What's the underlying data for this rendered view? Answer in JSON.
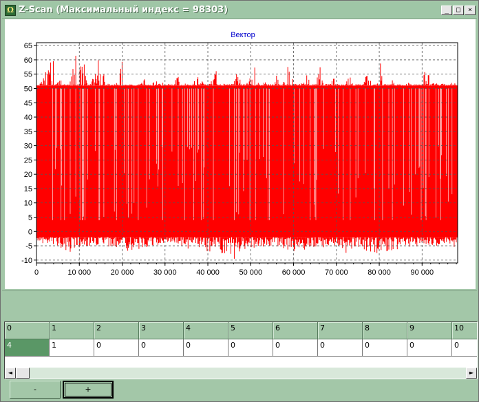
{
  "window": {
    "title": "Z-Scan (Максимальный индекс = 98303)",
    "app_icon": "app-icon",
    "controls": {
      "minimize": "_",
      "maximize": "□",
      "close": "×"
    }
  },
  "chart_data": {
    "type": "bar",
    "title": "Вектор",
    "xlabel": "",
    "ylabel": "",
    "xlim": [
      0,
      98303
    ],
    "ylim": [
      -11,
      66
    ],
    "yticks": [
      -10,
      -5,
      0,
      5,
      10,
      15,
      20,
      25,
      30,
      35,
      40,
      45,
      50,
      55,
      60,
      65
    ],
    "ytick_labels": [
      "-10",
      "-5",
      "0",
      "5",
      "10",
      "15",
      "20",
      "25",
      "30",
      "35",
      "40",
      "45",
      "50",
      "55",
      "60",
      "65"
    ],
    "xticks": [
      0,
      10000,
      20000,
      30000,
      40000,
      50000,
      60000,
      70000,
      80000,
      90000
    ],
    "xtick_labels": [
      "0",
      "10 000",
      "20 000",
      "30 000",
      "40 000",
      "50 000",
      "60 000",
      "70 000",
      "80 000",
      "90 000"
    ],
    "grid": true,
    "series_color": "#ff0000",
    "positive_profile": {
      "x": [
        0,
        1000,
        2000,
        3000,
        3500,
        4000,
        5000,
        6000,
        7000,
        8000,
        9000,
        9500,
        10000,
        11000,
        12000,
        13000,
        14000,
        15000,
        16000,
        17000,
        18000,
        19000,
        20000,
        21000,
        22000,
        23000,
        24000,
        25000,
        26000,
        27000,
        28000,
        29000,
        30000,
        31000,
        32000,
        33000,
        34000,
        35000,
        36000,
        37000,
        38000,
        39000,
        40000,
        41000,
        42000,
        43000,
        44000,
        45000,
        46000,
        47000,
        48000,
        49000,
        50000,
        51000,
        52000,
        53000,
        54000,
        55000,
        56000,
        57000,
        58000,
        59000,
        60000,
        61000,
        62000,
        63000,
        64000,
        65000,
        66000,
        67000,
        68000,
        69000,
        70000,
        71000,
        72000,
        73000,
        74000,
        75000,
        76000,
        77000,
        78000,
        79000,
        80000,
        81000,
        82000,
        83000,
        84000,
        85000,
        86000,
        87000,
        88000,
        89000,
        90000,
        91000,
        92000,
        93000,
        94000,
        95000,
        96000,
        97000,
        98303
      ],
      "y": [
        51,
        52,
        55,
        63,
        58,
        61,
        56,
        52,
        51,
        53,
        61,
        63,
        64,
        60,
        51,
        53,
        57,
        66,
        51,
        52,
        51,
        53,
        64,
        51,
        52,
        51,
        53,
        55,
        51,
        52,
        53,
        51,
        54,
        51,
        52,
        56,
        51,
        52,
        51,
        53,
        55,
        52,
        51,
        54,
        57,
        51,
        52,
        51,
        53,
        56,
        51,
        52,
        54,
        58,
        51,
        53,
        51,
        52,
        57,
        51,
        53,
        61,
        52,
        51,
        54,
        57,
        51,
        52,
        60,
        51,
        52,
        56,
        51,
        53,
        51,
        55,
        51,
        52,
        51,
        56,
        53,
        51,
        63,
        52,
        51,
        53,
        51,
        52,
        51,
        53,
        52,
        51,
        52,
        61,
        51,
        53,
        51,
        52,
        51,
        53,
        51
      ],
      "baseline": 51
    },
    "negative_profile": {
      "x": [
        0,
        5000,
        9000,
        10000,
        15000,
        20000,
        25000,
        30000,
        35000,
        40000,
        45000,
        46500,
        50000,
        55000,
        60000,
        65000,
        70000,
        73000,
        75000,
        80000,
        85000,
        90000,
        95000,
        98303
      ],
      "y": [
        -4,
        -5,
        -9,
        -6,
        -5,
        -7,
        -6,
        -5,
        -6,
        -7,
        -8,
        -11,
        -6,
        -5,
        -7,
        -6,
        -5,
        -9,
        -6,
        -8,
        -6,
        -5,
        -5,
        -6
      ],
      "baseline": -2
    }
  },
  "grid": {
    "headers": [
      "0",
      "1",
      "2",
      "3",
      "4",
      "5",
      "6",
      "7",
      "8",
      "9",
      "10"
    ],
    "row": [
      "4",
      "1",
      "0",
      "0",
      "0",
      "0",
      "0",
      "0",
      "0",
      "0",
      "0"
    ]
  },
  "scrollbar": {
    "left_icon": "◄",
    "right_icon": "►"
  },
  "buttons": {
    "minus": "-",
    "plus": "+"
  }
}
